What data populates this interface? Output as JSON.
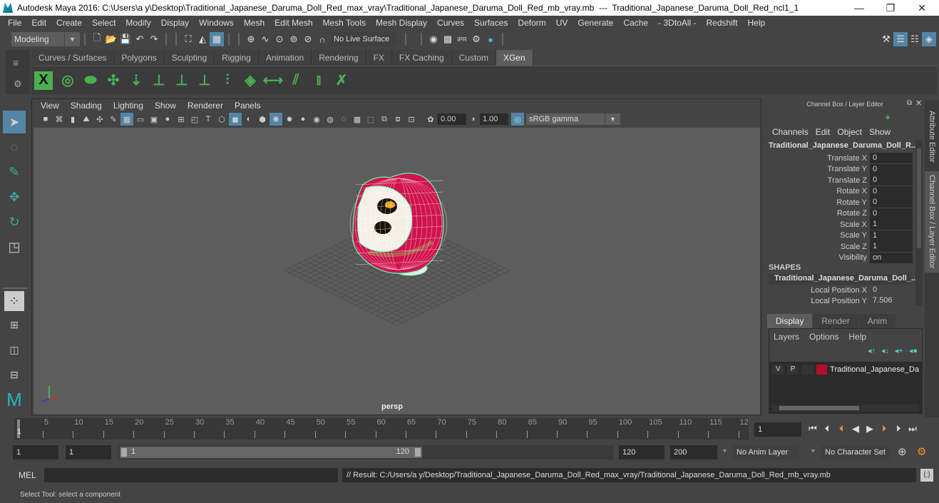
{
  "window": {
    "title": "Autodesk Maya 2016: C:\\Users\\a y\\Desktop\\Traditional_Japanese_Daruma_Doll_Red_max_vray\\Traditional_Japanese_Daruma_Doll_Red_mb_vray.mb  ---  Traditional_Japanese_Daruma_Doll_Red_ncl1_1",
    "minimize": "—",
    "maximize": "❐",
    "close": "✕"
  },
  "menubar": [
    "File",
    "Edit",
    "Create",
    "Select",
    "Modify",
    "Display",
    "Windows",
    "Mesh",
    "Edit Mesh",
    "Mesh Tools",
    "Mesh Display",
    "Curves",
    "Surfaces",
    "Deform",
    "UV",
    "Generate",
    "Cache",
    "- 3DtoAll -",
    "Redshift",
    "Help"
  ],
  "statusline": {
    "mode": "Modeling",
    "live_surface": "No Live Surface"
  },
  "shelf": {
    "tabs": [
      "Curves / Surfaces",
      "Polygons",
      "Sculpting",
      "Rigging",
      "Animation",
      "Rendering",
      "FX",
      "FX Caching",
      "Custom",
      "XGen"
    ],
    "active_tab": "XGen"
  },
  "panel": {
    "menu": [
      "View",
      "Shading",
      "Lighting",
      "Show",
      "Renderer",
      "Panels"
    ],
    "exposure": "0.00",
    "gamma": "1.00",
    "color_space": "sRGB gamma",
    "camera_label": "persp"
  },
  "channel_box": {
    "title": "Channel Box / Layer Editor",
    "menu": [
      "Channels",
      "Edit",
      "Object",
      "Show"
    ],
    "object_name": "Traditional_Japanese_Daruma_Doll_R...",
    "channels": [
      {
        "label": "Translate X",
        "value": "0"
      },
      {
        "label": "Translate Y",
        "value": "0"
      },
      {
        "label": "Translate Z",
        "value": "0"
      },
      {
        "label": "Rotate X",
        "value": "0"
      },
      {
        "label": "Rotate Y",
        "value": "0"
      },
      {
        "label": "Rotate Z",
        "value": "0"
      },
      {
        "label": "Scale X",
        "value": "1"
      },
      {
        "label": "Scale Y",
        "value": "1"
      },
      {
        "label": "Scale Z",
        "value": "1"
      },
      {
        "label": "Visibility",
        "value": "on"
      }
    ],
    "shapes_header": "SHAPES",
    "shape_name": "Traditional_Japanese_Daruma_Doll_...",
    "shape_channels": [
      {
        "label": "Local Position X",
        "value": "0"
      },
      {
        "label": "Local Position Y",
        "value": "7.506"
      }
    ]
  },
  "side_tabs": [
    "Attribute Editor",
    "Channel Box / Layer Editor"
  ],
  "layer_editor": {
    "tabs": [
      "Display",
      "Render",
      "Anim"
    ],
    "active_tab": "Display",
    "menu": [
      "Layers",
      "Options",
      "Help"
    ],
    "layers": [
      {
        "v": "V",
        "p": "P",
        "color": "#b0102a",
        "name": "Traditional_Japanese_Da"
      }
    ]
  },
  "timeline": {
    "ticks": [
      "5",
      "10",
      "15",
      "20",
      "25",
      "30",
      "35",
      "40",
      "45",
      "50",
      "55",
      "60",
      "65",
      "70",
      "75",
      "80",
      "85",
      "90",
      "95",
      "100",
      "105",
      "110",
      "115",
      "12"
    ],
    "current_frame_marker": "1",
    "current_frame": "1",
    "range_start": "1",
    "playback_start": "1",
    "range_slider_start": "1",
    "range_slider_end": "120",
    "playback_end": "120",
    "range_end": "200",
    "anim_layer": "No Anim Layer",
    "character_set": "No Character Set"
  },
  "command_line": {
    "language": "MEL",
    "input": "",
    "result": "// Result: C:/Users/a y/Desktop/Traditional_Japanese_Daruma_Doll_Red_max_vray/Traditional_Japanese_Daruma_Doll_Red_mb_vray.mb"
  },
  "help_line": "Select Tool: select a component",
  "colors": {
    "accent": "#5285a6",
    "wireframe": "#5dffb0",
    "doll_red": "#d0134e",
    "viewport_bg": "#5d5d5d"
  }
}
